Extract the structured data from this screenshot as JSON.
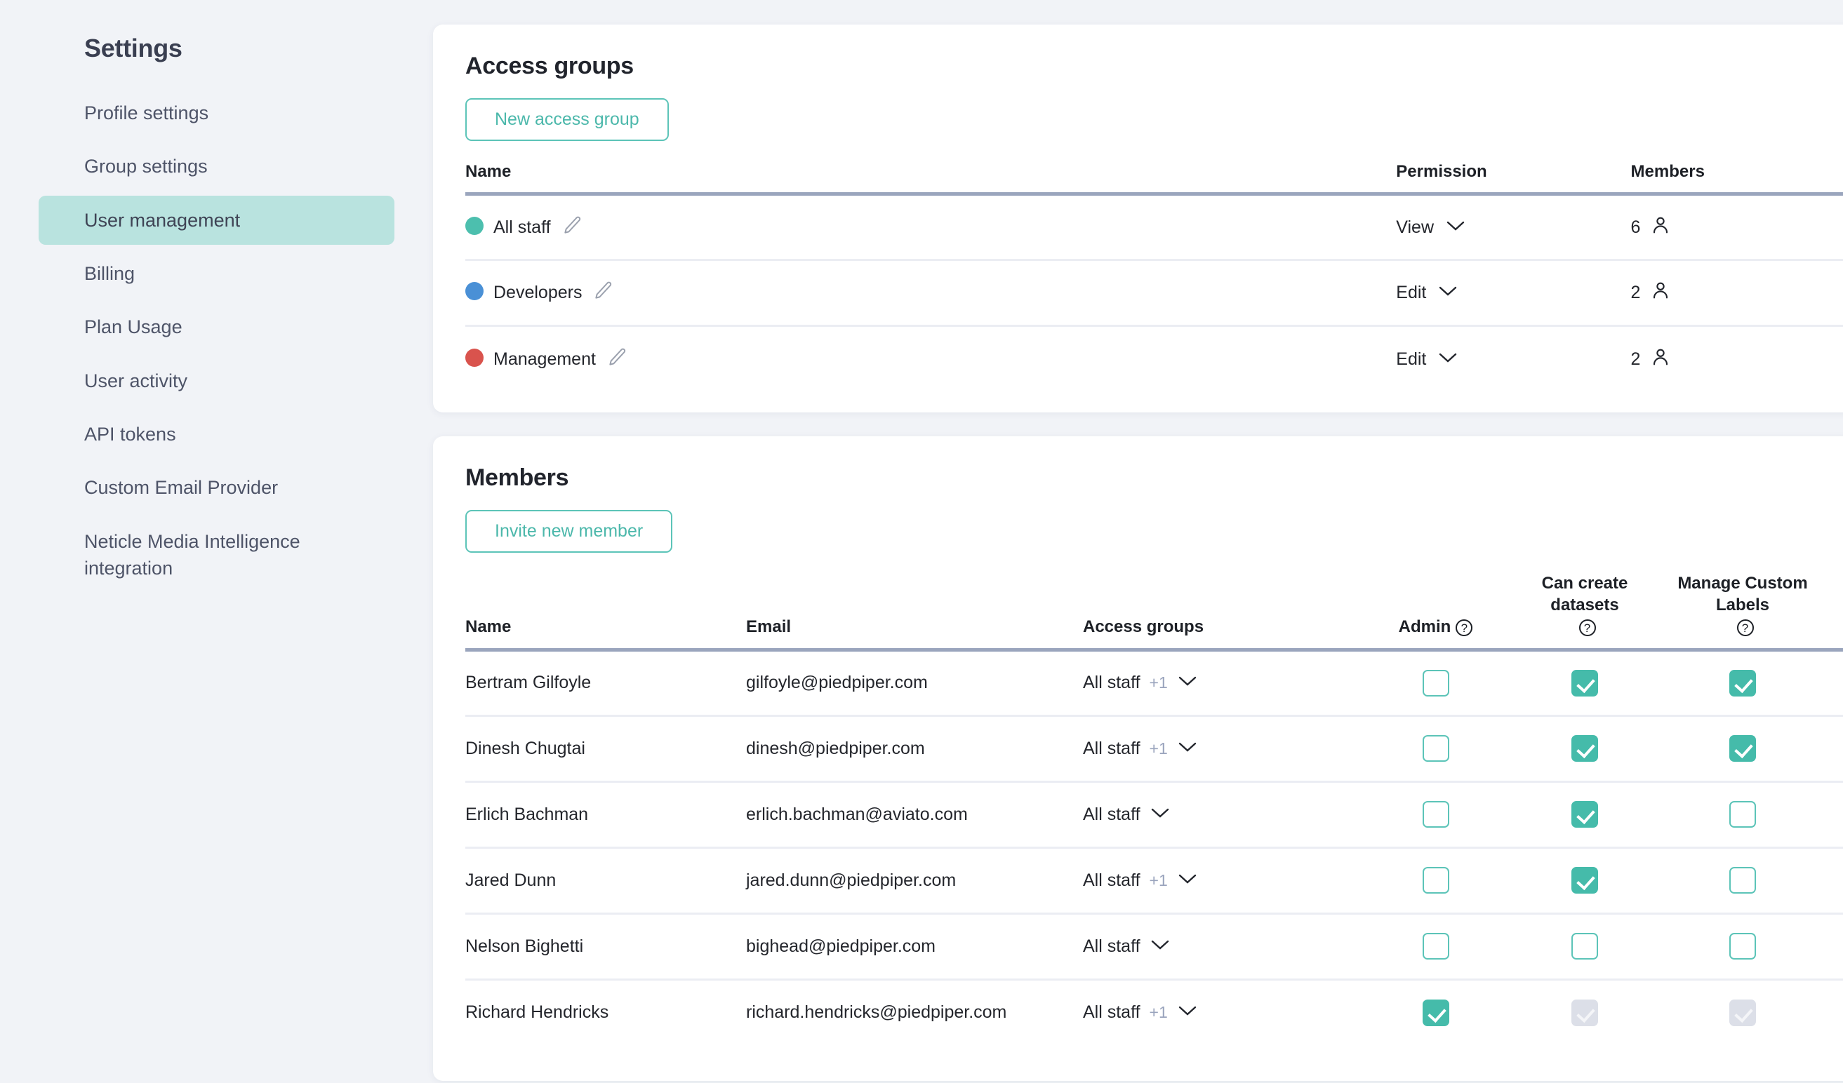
{
  "sidebar": {
    "title": "Settings",
    "items": [
      {
        "label": "Profile settings",
        "active": false
      },
      {
        "label": "Group settings",
        "active": false
      },
      {
        "label": "User management",
        "active": true
      },
      {
        "label": "Billing",
        "active": false
      },
      {
        "label": "Plan Usage",
        "active": false
      },
      {
        "label": "User activity",
        "active": false
      },
      {
        "label": "API tokens",
        "active": false
      },
      {
        "label": "Custom Email Provider",
        "active": false
      },
      {
        "label": "Neticle Media Intelligence integration",
        "active": false
      }
    ]
  },
  "access_groups": {
    "title": "Access groups",
    "new_button": "New access group",
    "columns": {
      "name": "Name",
      "permission": "Permission",
      "members": "Members"
    },
    "rows": [
      {
        "name": "All staff",
        "color": "#4cbfae",
        "permission": "View",
        "members": "6"
      },
      {
        "name": "Developers",
        "color": "#4a90d6",
        "permission": "Edit",
        "members": "2"
      },
      {
        "name": "Management",
        "color": "#d9534d",
        "permission": "Edit",
        "members": "2"
      }
    ],
    "permission_options": [
      "View",
      "Edit"
    ]
  },
  "members": {
    "title": "Members",
    "invite_button": "Invite new member",
    "columns": {
      "name": "Name",
      "email": "Email",
      "access_groups": "Access groups",
      "admin": "Admin",
      "can_create_datasets": "Can create datasets",
      "manage_custom_labels": "Manage Custom Labels"
    },
    "rows": [
      {
        "name": "Bertram Gilfoyle",
        "email": "gilfoyle@piedpiper.com",
        "group": "All staff",
        "extra": "+1",
        "admin": "unchecked",
        "datasets": "checked",
        "labels": "checked"
      },
      {
        "name": "Dinesh Chugtai",
        "email": "dinesh@piedpiper.com",
        "group": "All staff",
        "extra": "+1",
        "admin": "unchecked",
        "datasets": "checked",
        "labels": "checked"
      },
      {
        "name": "Erlich Bachman",
        "email": "erlich.bachman@aviato.com",
        "group": "All staff",
        "extra": "",
        "admin": "unchecked",
        "datasets": "checked",
        "labels": "unchecked"
      },
      {
        "name": "Jared Dunn",
        "email": "jared.dunn@piedpiper.com",
        "group": "All staff",
        "extra": "+1",
        "admin": "unchecked",
        "datasets": "checked",
        "labels": "unchecked"
      },
      {
        "name": "Nelson Bighetti",
        "email": "bighead@piedpiper.com",
        "group": "All staff",
        "extra": "",
        "admin": "unchecked",
        "datasets": "unchecked",
        "labels": "unchecked"
      },
      {
        "name": "Richard Hendricks",
        "email": "richard.hendricks@piedpiper.com",
        "group": "All staff",
        "extra": "+1",
        "admin": "checked",
        "datasets": "disabled",
        "labels": "disabled"
      }
    ]
  },
  "colors": {
    "accent": "#4cb8ab",
    "danger": "#d9534d",
    "sidebar_active_bg": "#b9e3df",
    "page_bg": "#f1f3f7"
  }
}
